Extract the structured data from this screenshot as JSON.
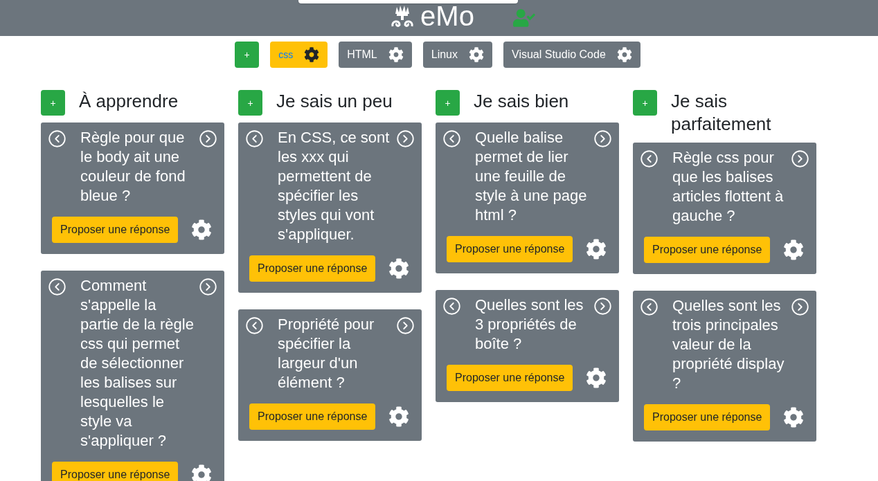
{
  "header": {
    "logo_text": "eMo"
  },
  "categories": {
    "add_label": "+",
    "items": [
      {
        "label": "css",
        "selected": true
      },
      {
        "label": "HTML",
        "selected": false
      },
      {
        "label": "Linux",
        "selected": false
      },
      {
        "label": "Visual Studio Code",
        "selected": false
      }
    ]
  },
  "columns": [
    {
      "add_label": "+",
      "title": "À apprendre",
      "cards": [
        {
          "question": "Règle pour que le body ait une couleur de fond bleue ?",
          "button": "Proposer une réponse"
        },
        {
          "question": "Comment s'appelle la partie de la règle css qui permet de sélectionner les balises sur lesquelles le style va s'appliquer ?",
          "button": "Proposer une réponse"
        }
      ]
    },
    {
      "add_label": "+",
      "title": "Je sais un peu",
      "cards": [
        {
          "question": "En CSS, ce sont les xxx qui permettent de spécifier les styles qui vont s'appliquer.",
          "button": "Proposer une réponse"
        },
        {
          "question": "Propriété pour spécifier la largeur d'un élément ?",
          "button": "Proposer une réponse"
        }
      ]
    },
    {
      "add_label": "+",
      "title": "Je sais bien",
      "cards": [
        {
          "question": "Quelle balise permet de lier une feuille de style à une page html ?",
          "button": "Proposer une réponse"
        },
        {
          "question": "Quelles sont les 3 propriétés de boîte ?",
          "button": "Proposer une réponse"
        }
      ]
    },
    {
      "add_label": "+",
      "title": "Je sais parfaitement",
      "cards": [
        {
          "question": "Règle css pour que les balises articles flottent à gauche ?",
          "button": "Proposer une réponse"
        },
        {
          "question": "Quelles sont les trois principales valeur de la propriété display ?",
          "button": "Proposer une réponse"
        }
      ]
    }
  ]
}
